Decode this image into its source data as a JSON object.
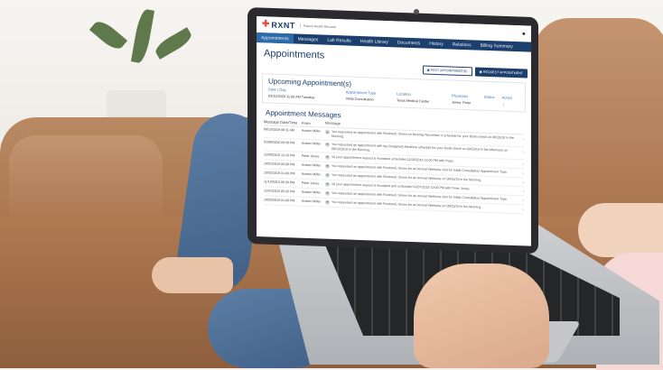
{
  "app": {
    "logo_text": "RXNT",
    "logo_subtitle": "Patient Health Records"
  },
  "nav": {
    "items": [
      {
        "label": "Appointments",
        "active": true
      },
      {
        "label": "Messages",
        "active": false
      },
      {
        "label": "Lab Results",
        "active": false
      },
      {
        "label": "Health Library",
        "active": false
      },
      {
        "label": "Documents",
        "active": false
      },
      {
        "label": "History",
        "active": false
      },
      {
        "label": "Relations",
        "active": false
      },
      {
        "label": "Billing Summary",
        "active": false
      }
    ]
  },
  "page": {
    "title": "Appointments",
    "past_button": "PAST APPOINTMENT(S)",
    "request_button": "REQUEST APPOINTMENT"
  },
  "upcoming": {
    "title": "Upcoming Appointment(s)",
    "columns": [
      "Date / Day",
      "Appointment Type",
      "Location",
      "Physician",
      "Status",
      "Action"
    ],
    "rows": [
      {
        "date": "03/12/2020 11:00 AM Tuesday",
        "type": "Initial Consultation",
        "location": "Texas Medical Center",
        "physician": "Jones, Peter",
        "status": ""
      }
    ]
  },
  "messages": {
    "title": "Appointment Messages",
    "columns": [
      "Message Date/Time",
      "From",
      "Message"
    ],
    "rows": [
      {
        "date": "09/13/2019 08:11 AM",
        "from": "Kristen Miller",
        "text": "You requested an appointment with Rockwell, Simon on Monday November 4 schedule for your Biotin check on 09/15/19 in the Morning."
      },
      {
        "date": "01/08/2020 09:36 PM",
        "from": "Kristen Miller",
        "text": "You requested an appointment with Ag (Assigned) Medicine schedule for your Biotin check on 09/15/19 in the Afternoon on 08/13/2019 in the Morning."
      },
      {
        "date": "12/09/2019 12:10 PM",
        "from": "Peter Jones",
        "text": "10 your appointment request is Accepted scheduled 12/28/2019 12:00 PM with Peter."
      },
      {
        "date": "10/01/2019 05:06 PM",
        "from": "Kristen Miller",
        "text": "You requested an appointment with Rockwell, Simon for an Annual Wellness visit for Initial Consultation Appointment Type."
      },
      {
        "date": "10/02/2019 01:00 PM",
        "from": "Kristen Miller",
        "text": "You requested an appointment with Rockwell, Simon for an Annual Wellness on 09/15/19 in the Morning."
      },
      {
        "date": "11/19/2019 05:39 PM",
        "from": "Peter Jones",
        "text": "10 your appointment request is Accepted and scheduled 12/07/2019 10:00 PM with Peter Jones."
      },
      {
        "date": "12/01/2019 05:20 PM",
        "from": "Kristen Miller",
        "text": "You requested an appointment with Rockwell, Simon for an Annual Wellness visit for Initial Consultation Appointment Type."
      },
      {
        "date": "10/02/2019 01:00 PM",
        "from": "Kristen Miller",
        "text": "You requested an appointment with Rockwell, Simon for an Annual Wellness on 09/15/19 in the Morning."
      }
    ]
  },
  "colors": {
    "brand_navy": "#1c3f6e",
    "nav_active": "#2d6aa8",
    "status_orange": "#f39c28",
    "logo_red": "#e74c3c"
  },
  "icons": {
    "user": "user-icon",
    "message": "message-icon",
    "calendar": "calendar-icon",
    "chevron": "chevron-right-icon"
  }
}
